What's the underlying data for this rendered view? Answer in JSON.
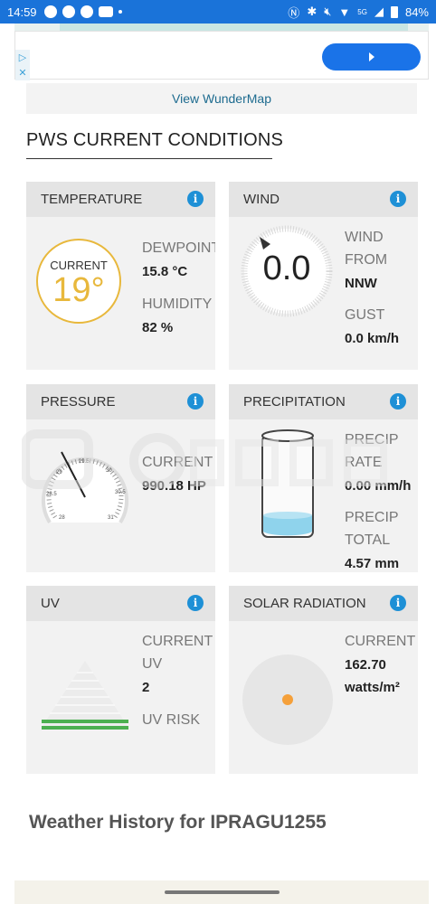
{
  "status_bar": {
    "time": "14:59",
    "battery": "84%",
    "network": "5G"
  },
  "ad": {
    "choice_play": "▷",
    "choice_close": "✕",
    "cta_icon": "chevron-right-icon"
  },
  "map_link": "View WunderMap",
  "section_title": "PWS CURRENT CONDITIONS",
  "info_glyph": "i",
  "temperature": {
    "title": "TEMPERATURE",
    "current_label": "CURRENT",
    "current_value": "19°",
    "dewpoint_label": "DEWPOINT",
    "dewpoint_value": "15.8 °C",
    "humidity_label": "HUMIDITY",
    "humidity_value": "82 %"
  },
  "wind": {
    "title": "WIND",
    "speed": "0.0",
    "from_label_1": "WIND",
    "from_label_2": "FROM",
    "from_value": "NNW",
    "gust_label": "GUST",
    "gust_value": "0.0 km/h"
  },
  "pressure": {
    "title": "PRESSURE",
    "current_label": "CURRENT",
    "current_value": "990.18 HP",
    "gauge_ticks": [
      "28",
      "28.5",
      "29",
      "29.5",
      "30",
      "30.5",
      "31"
    ]
  },
  "precipitation": {
    "title": "PRECIPITATION",
    "rate_label_1": "PRECIP",
    "rate_label_2": "RATE",
    "rate_value": "0.00 mm/h",
    "total_label_1": "PRECIP",
    "total_label_2": "TOTAL",
    "total_value": "4.57 mm"
  },
  "uv": {
    "title": "UV",
    "current_label_1": "CURRENT",
    "current_label_2": "UV",
    "current_value": "2",
    "risk_label": "UV RISK"
  },
  "solar": {
    "title": "SOLAR RADIATION",
    "current_label": "CURRENT",
    "value": "162.70",
    "unit": "watts/m²"
  },
  "history_title": "Weather History for IPRAGU1255",
  "colors": {
    "accent_blue": "#1e90d6",
    "temp_yellow": "#e8b83c",
    "uv_green": "#4caf50",
    "solar_orange": "#f5a03a",
    "water_blue": "#8fd3ec"
  }
}
